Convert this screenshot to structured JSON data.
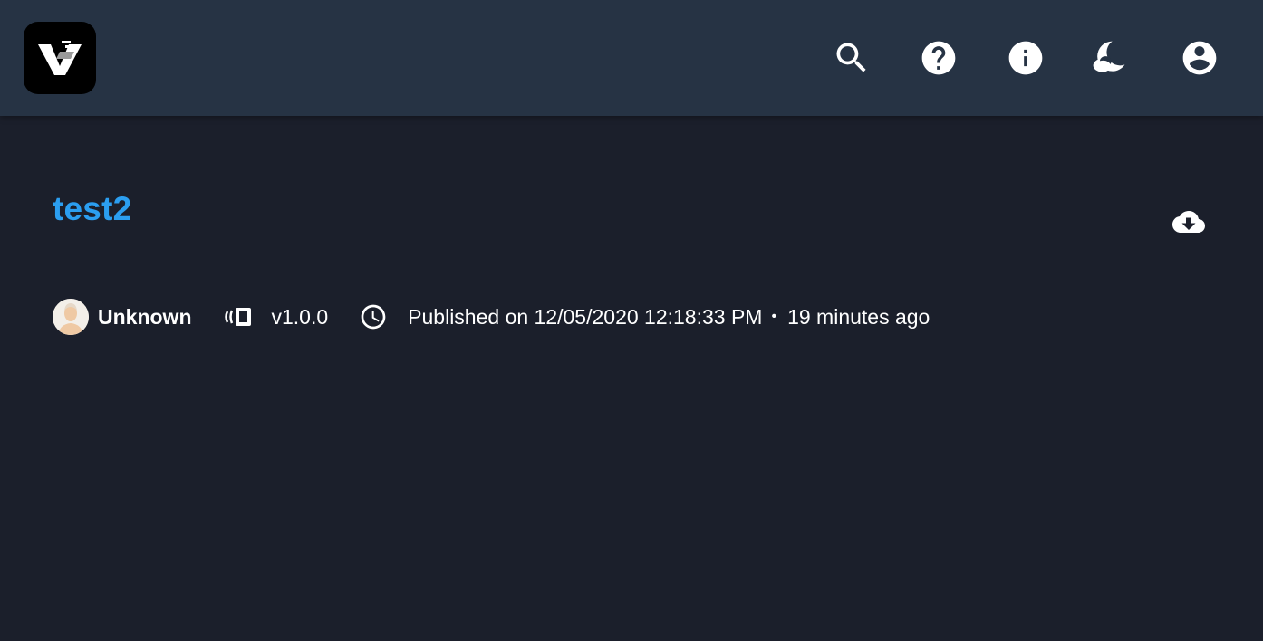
{
  "header": {
    "logo_icon": "v-logo-icon",
    "buttons": [
      {
        "icon": "search-icon"
      },
      {
        "icon": "help-icon"
      },
      {
        "icon": "info-icon"
      },
      {
        "icon": "dark-mode-icon"
      },
      {
        "icon": "account-icon"
      }
    ]
  },
  "package": {
    "title": "test2",
    "download_icon": "cloud-download-icon",
    "author": "Unknown",
    "version": "v1.0.0",
    "published_label": "Published on 12/05/2020 12:18:33 PM",
    "separator": "•",
    "relative_time": "19 minutes ago"
  },
  "colors": {
    "header_bg": "#263344",
    "page_bg": "#1b1f2b",
    "title": "#2b9ef0",
    "text": "#ffffff"
  }
}
